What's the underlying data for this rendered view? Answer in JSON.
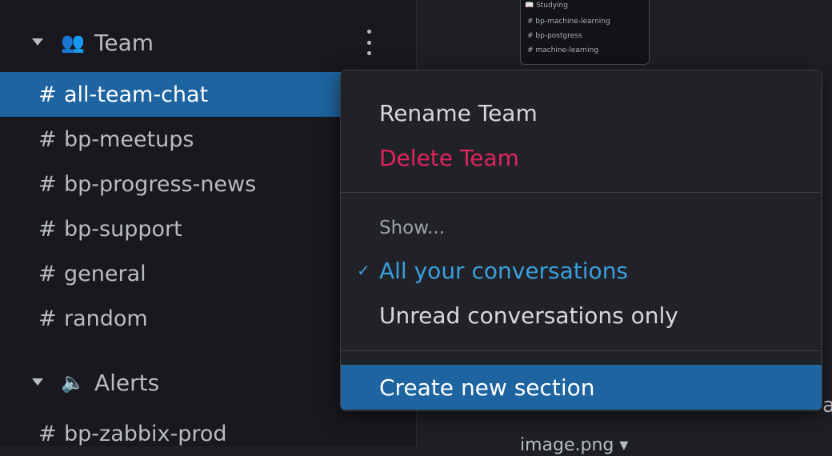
{
  "sidebar": {
    "team_section": {
      "emoji": "👥",
      "title": "Team"
    },
    "channels": [
      {
        "name": "all-team-chat",
        "active": true
      },
      {
        "name": "bp-meetups"
      },
      {
        "name": "bp-progress-news"
      },
      {
        "name": "bp-support"
      },
      {
        "name": "general"
      },
      {
        "name": "random"
      }
    ],
    "alerts_section": {
      "emoji": "🔈",
      "title": "Alerts"
    },
    "alerts_channels": [
      {
        "name": "bp-zabbix-prod"
      }
    ],
    "hash": "#"
  },
  "preview_thumbnail": {
    "section": "📖 Studying",
    "rows": [
      "# bp-machine-learning",
      "# bp-postgress",
      "# machine-learning"
    ]
  },
  "main": {
    "attachment_name": "image.png ▾",
    "edge_text": "ac"
  },
  "context_menu": {
    "rename": "Rename Team",
    "delete": "Delete Team",
    "show_label": "Show...",
    "all_conversations": "All your conversations",
    "unread_only": "Unread conversations only",
    "create_section": "Create new section",
    "check": "✓"
  },
  "colors": {
    "active_bg": "#1d64a0",
    "danger": "#e0245e",
    "selected": "#3aa0dd"
  }
}
